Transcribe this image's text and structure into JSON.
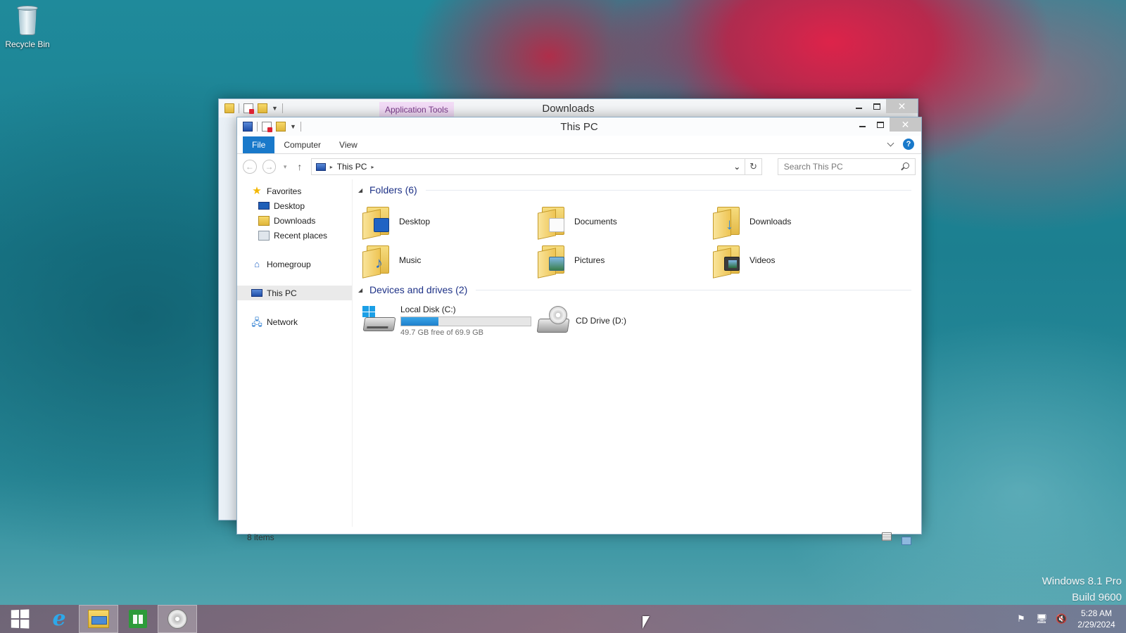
{
  "desktop": {
    "recycle_bin_label": "Recycle Bin"
  },
  "window_back": {
    "title": "Downloads",
    "context_tab": "Application Tools",
    "minimize_glyph": "",
    "close_glyph": "✕"
  },
  "window_front": {
    "title": "This PC",
    "close_glyph": "✕",
    "ribbon": {
      "tabs": [
        "File",
        "Computer",
        "View"
      ],
      "help_glyph": "?"
    },
    "address": {
      "back_glyph": "←",
      "forward_glyph": "→",
      "recent_glyph": "▾",
      "up_glyph": "↑",
      "crumb_sep": "▸",
      "crumb": "This PC",
      "dropdown_glyph": "⌄",
      "refresh_glyph": "↻",
      "search_placeholder": "Search This PC"
    },
    "nav": {
      "favorites": "Favorites",
      "desktop": "Desktop",
      "downloads": "Downloads",
      "recent_places": "Recent places",
      "homegroup": "Homegroup",
      "this_pc": "This PC",
      "network": "Network",
      "star_glyph": "★",
      "home_glyph": "⌂",
      "net_glyph": "🖧"
    },
    "groups": {
      "folders_header": "Folders (6)",
      "devices_header": "Devices and drives (2)",
      "collapse_glyph": "◢"
    },
    "folders": [
      {
        "label": "Desktop",
        "icon": "desktop-folder-icon"
      },
      {
        "label": "Documents",
        "icon": "documents-folder-icon"
      },
      {
        "label": "Downloads",
        "icon": "downloads-folder-icon"
      },
      {
        "label": "Music",
        "icon": "music-folder-icon"
      },
      {
        "label": "Pictures",
        "icon": "pictures-folder-icon"
      },
      {
        "label": "Videos",
        "icon": "videos-folder-icon"
      }
    ],
    "drives": [
      {
        "label": "Local Disk (C:)",
        "free_text": "49.7 GB free of 69.9 GB",
        "used_fraction": 0.29,
        "icon": "hard-disk-icon"
      },
      {
        "label": "CD Drive (D:)",
        "icon": "cd-drive-icon"
      }
    ],
    "status": {
      "item_count": "8 items"
    }
  },
  "watermark": {
    "line1": "Windows 8.1 Pro",
    "line2": "Build 9600"
  },
  "taskbar": {
    "apps": [
      "start-icon",
      "internet-explorer-icon",
      "file-explorer-icon",
      "store-icon",
      "cd-app-icon"
    ],
    "tray": {
      "flag_glyph": "⚑",
      "network_glyph": "🖥",
      "volume_glyph": "🔇"
    },
    "clock": {
      "time": "5:28 AM",
      "date": "2/29/2024"
    }
  }
}
